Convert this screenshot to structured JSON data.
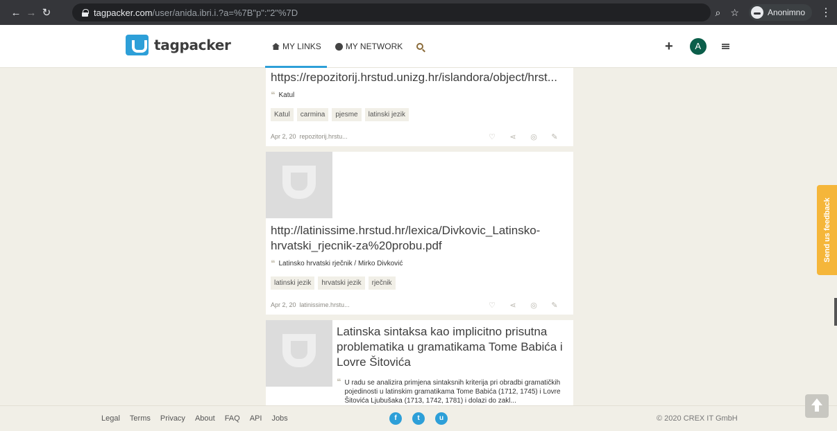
{
  "browser": {
    "url_host": "tagpacker.com",
    "url_rest": "/user/anida.ibri.i.?a=%7B\"p\":\"2\"%7D",
    "profile_label": "Anonimno"
  },
  "header": {
    "logo_text": "tagpacker",
    "nav": [
      "MY LINKS",
      "MY NETWORK"
    ],
    "avatar_letter": "A",
    "accent_color": "#2d9fd8"
  },
  "cards": [
    {
      "title": "https://repozitorij.hrstud.unizg.hr/islandora/object/hrst...",
      "quote": "Katul",
      "tags": [
        "Katul",
        "carmina",
        "pjesme",
        "latinski jezik"
      ],
      "date": "Apr 2, 20",
      "source": "repozitorij.hrstu..."
    },
    {
      "title": "http://latinissime.hrstud.hr/lexica/Divkovic_Latinsko-hrvatski_rjecnik-za%20probu.pdf",
      "quote": "Latinsko hrvatski rječnik / Mirko Divković",
      "tags": [
        "latinski jezik",
        "hrvatski jezik",
        "rječnik"
      ],
      "date": "Apr 2, 20",
      "source": "latinissime.hrstu..."
    },
    {
      "title": "Latinska sintaksa kao implicitno prisutna problematika u gramatikama Tome Babića i Lovre Šitovića",
      "quote": "U radu se analizira primjena sintaksnih kriterija pri obradbi gramatičkih pojedinosti u latinskim gramatikama Tome Babića (1712, 1745) i Lovre Šitovića Ljubušaka (1713, 1742, 1781) i dolazi do zakl..."
    }
  ],
  "footer": {
    "links": [
      "Legal",
      "Terms",
      "Privacy",
      "About",
      "FAQ",
      "API",
      "Jobs"
    ],
    "copyright": "© 2020 CREX IT GmbH"
  },
  "feedback_label": "Send us feedback"
}
